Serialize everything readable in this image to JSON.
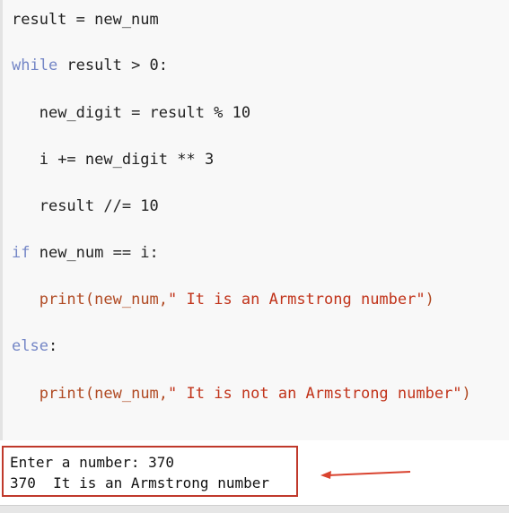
{
  "code_lines": [
    {
      "indent": "",
      "parts": [
        {
          "t": "result = new_num",
          "c": ""
        }
      ]
    },
    {
      "indent": "",
      "parts": [
        {
          "t": "while",
          "c": "kw"
        },
        {
          "t": " result > 0:",
          "c": ""
        }
      ]
    },
    {
      "indent": "   ",
      "parts": [
        {
          "t": "new_digit = result % 10",
          "c": ""
        }
      ]
    },
    {
      "indent": "   ",
      "parts": [
        {
          "t": "i += new_digit ** 3",
          "c": ""
        }
      ]
    },
    {
      "indent": "   ",
      "parts": [
        {
          "t": "result //= 10",
          "c": ""
        }
      ]
    },
    {
      "indent": "",
      "parts": [
        {
          "t": "if",
          "c": "kw"
        },
        {
          "t": " new_num == i:",
          "c": ""
        }
      ]
    },
    {
      "indent": "   ",
      "parts": [
        {
          "t": "print",
          "c": "fn"
        },
        {
          "t": "(new_num,",
          "c": "fn"
        },
        {
          "t": "\" It is an Armstrong number\"",
          "c": "str"
        },
        {
          "t": ")",
          "c": "fn"
        }
      ]
    },
    {
      "indent": "",
      "parts": [
        {
          "t": "else",
          "c": "kw"
        },
        {
          "t": ":",
          "c": ""
        }
      ]
    },
    {
      "indent": "   ",
      "parts": [
        {
          "t": "print",
          "c": "fn"
        },
        {
          "t": "(new_num,",
          "c": "fn"
        },
        {
          "t": "\" It is not an Armstrong number\"",
          "c": "str"
        },
        {
          "t": ")",
          "c": "fn"
        }
      ]
    }
  ],
  "output": {
    "line1": "Enter a number: 370",
    "line2": "370  It is an Armstrong number"
  },
  "colors": {
    "keyword": "#7486c6",
    "string": "#c1331a",
    "highlight_box": "#c0392b"
  }
}
